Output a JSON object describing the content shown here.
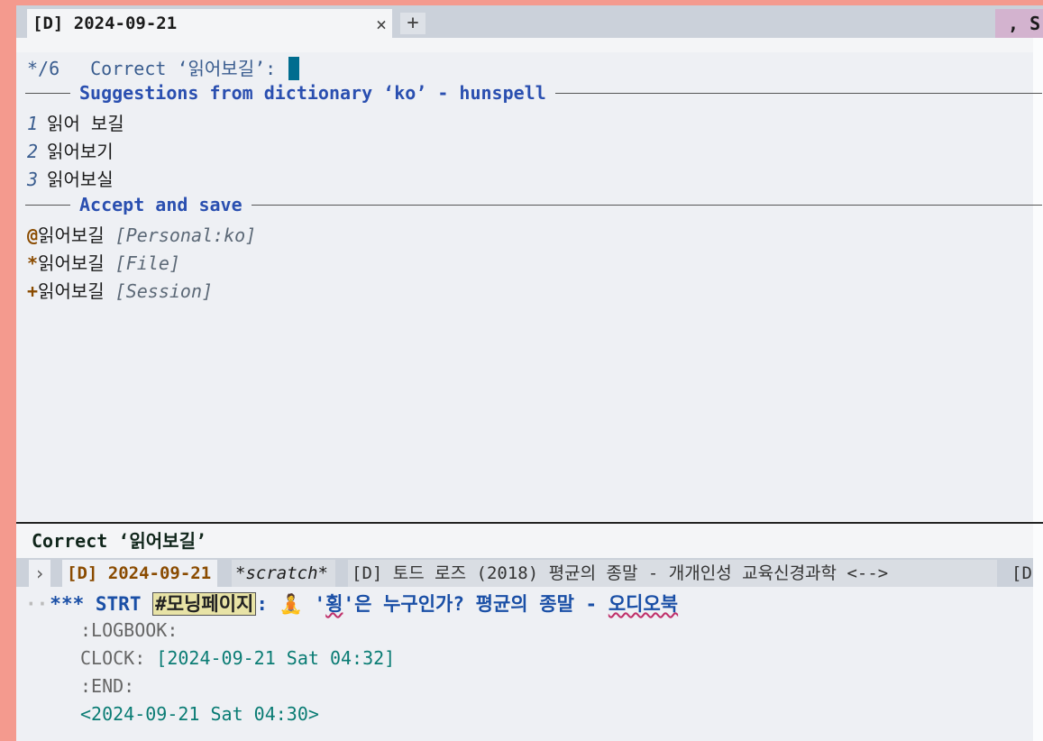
{
  "window": {
    "tab_title": "[D] 2024-09-21",
    "tab_close": "×",
    "tab_add": "+",
    "tab_right_fragment": ", S"
  },
  "minibuffer": {
    "count": "*/6",
    "prompt": "Correct ‘읽어보길’:",
    "suggestions_header": "Suggestions from dictionary ‘ko’ - hunspell",
    "suggestions": [
      {
        "index": "1",
        "word": "읽어 보길"
      },
      {
        "index": "2",
        "word": "읽어보기"
      },
      {
        "index": "3",
        "word": "읽어보실"
      }
    ],
    "accept_header": "Accept and save",
    "accept_options": [
      {
        "symbol": "@",
        "word": "읽어보길",
        "tag": "[Personal:ko]"
      },
      {
        "symbol": "*",
        "word": "읽어보길",
        "tag": "[File]"
      },
      {
        "symbol": "+",
        "word": "읽어보길",
        "tag": "[Session]"
      }
    ]
  },
  "header_line": "Correct ‘읽어보길’",
  "buffer_tabs": {
    "arrow": "›",
    "current": "[D] 2024-09-21",
    "scratch": "*scratch*",
    "long_tab": "[D] 토드 로즈 (2018) 평균의 종말 - 개개인성 교육신경과학 <-->",
    "more": "[D"
  },
  "buffer": {
    "heading_stars": "***",
    "heading_keyword": "STRT",
    "heading_tag": "#모닝페이지",
    "heading_colon": ":",
    "heading_emoji": "🧘",
    "heading_title_a": "'",
    "heading_title_squig": "횡",
    "heading_title_b": "'은 누구인가? 평균의 종말 - ",
    "heading_title_squig2": "오디오북",
    "logbook": ":LOGBOOK:",
    "clock_label": "CLOCK:",
    "clock_value": "[2024-09-21 Sat 04:32]",
    "end": ":END:",
    "timestamp": "<2024-09-21 Sat 04:30>"
  }
}
